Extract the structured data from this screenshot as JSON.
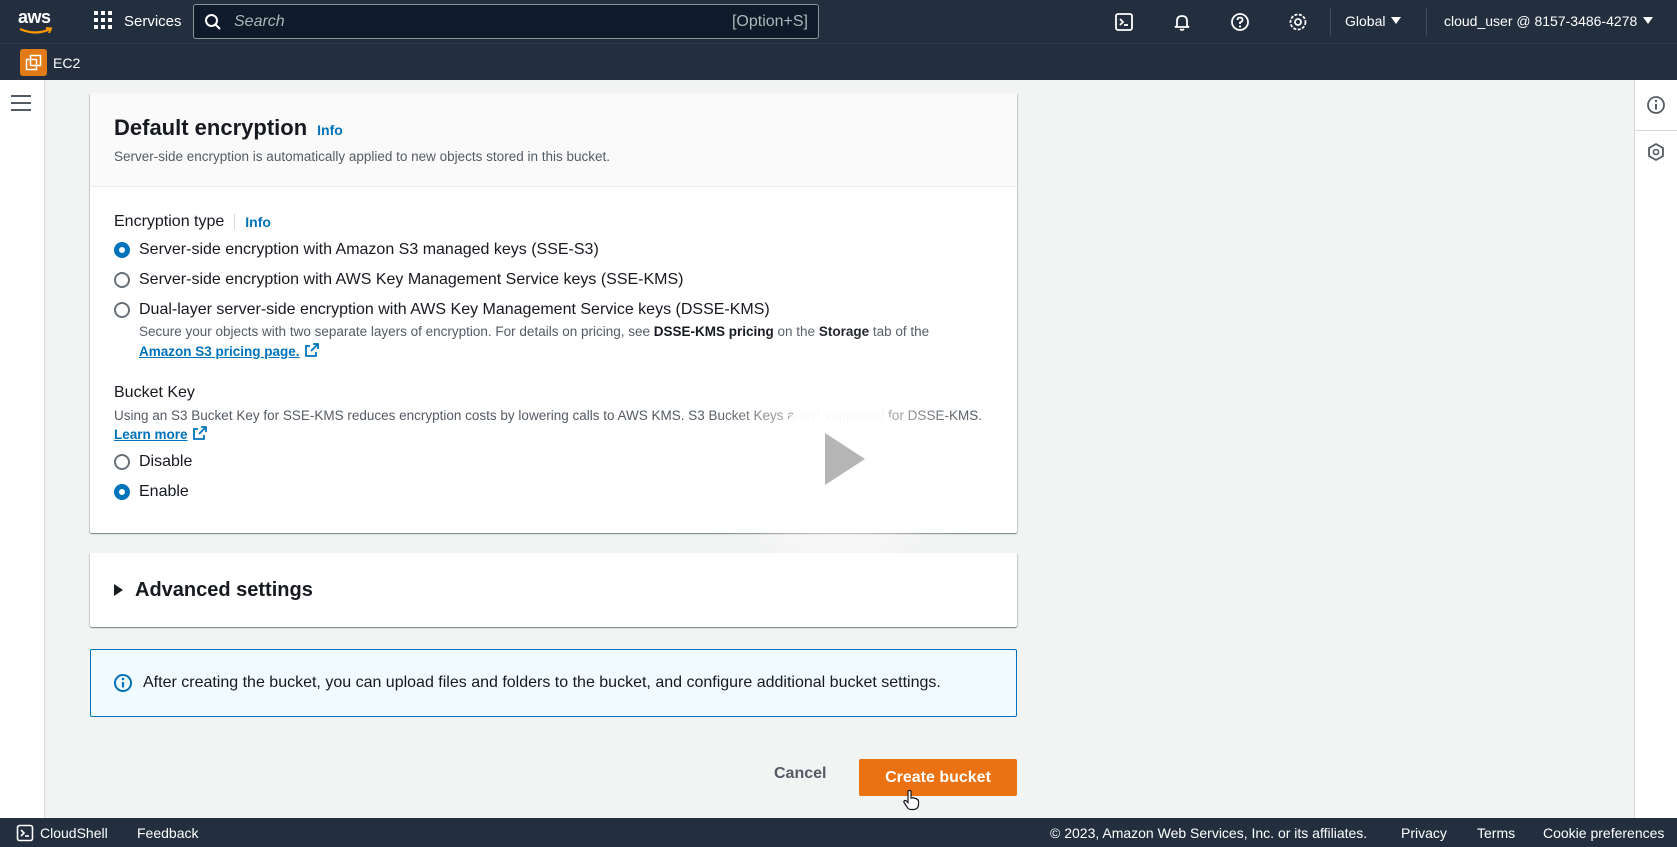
{
  "topnav": {
    "logo_text": "aws",
    "services_label": "Services",
    "search_placeholder": "Search",
    "search_shortcut": "[Option+S]",
    "region": "Global",
    "account": "cloud_user @ 8157-3486-4278"
  },
  "subnav": {
    "service_label": "EC2"
  },
  "encryption": {
    "title": "Default encryption",
    "info": "Info",
    "description": "Server-side encryption is automatically applied to new objects stored in this bucket.",
    "type_label": "Encryption type",
    "type_info": "Info",
    "options": [
      {
        "label": "Server-side encryption with Amazon S3 managed keys (SSE-S3)",
        "checked": true
      },
      {
        "label": "Server-side encryption with AWS Key Management Service keys (SSE-KMS)",
        "checked": false
      },
      {
        "label": "Dual-layer server-side encryption with AWS Key Management Service keys (DSSE-KMS)",
        "checked": false
      }
    ],
    "dsse_desc_1": "Secure your objects with two separate layers of encryption. For details on pricing, see ",
    "dsse_desc_bold1": "DSSE-KMS pricing",
    "dsse_desc_2": " on the ",
    "dsse_desc_bold2": "Storage",
    "dsse_desc_3": " tab of the",
    "pricing_link": "Amazon S3 pricing page.",
    "bucket_key_label": "Bucket Key",
    "bucket_key_desc": "Using an S3 Bucket Key for SSE-KMS reduces encryption costs by lowering calls to AWS KMS. S3 Bucket Keys aren't supported for DSSE-KMS. ",
    "learn_more": "Learn more",
    "bucket_key_options": [
      {
        "label": "Disable",
        "checked": false
      },
      {
        "label": "Enable",
        "checked": true
      }
    ]
  },
  "advanced": {
    "title": "Advanced settings"
  },
  "alert": {
    "text": "After creating the bucket, you can upload files and folders to the bucket, and configure additional bucket settings."
  },
  "actions": {
    "cancel": "Cancel",
    "create": "Create bucket"
  },
  "footer": {
    "cloudshell": "CloudShell",
    "feedback": "Feedback",
    "copyright": "© 2023, Amazon Web Services, Inc. or its affiliates.",
    "privacy": "Privacy",
    "terms": "Terms",
    "cookies": "Cookie preferences"
  },
  "colors": {
    "nav_bg": "#232f3e",
    "primary_button": "#ec7211",
    "link": "#0073bb",
    "ec2_badge": "#e07b18"
  }
}
